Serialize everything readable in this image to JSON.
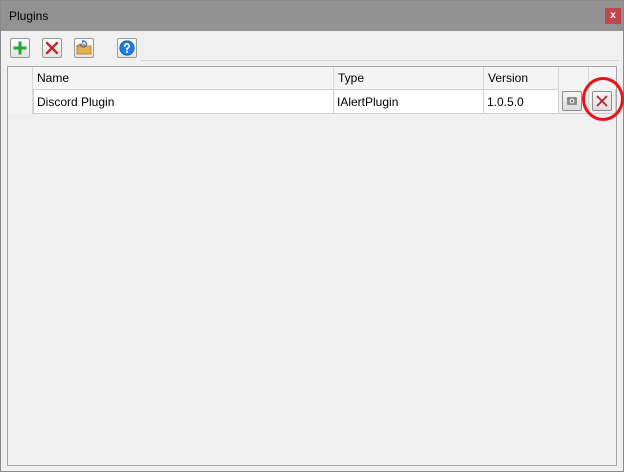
{
  "window": {
    "title": "Plugins",
    "close_label": "x"
  },
  "toolbar": {
    "buttons": [
      {
        "icon": "add-icon",
        "color": "#1a9c2a"
      },
      {
        "icon": "delete-icon",
        "color": "#c0282d"
      },
      {
        "icon": "folder-refresh-icon",
        "color": "#3f6fd1"
      },
      {
        "icon": "help-icon",
        "color": "#1e7de0"
      }
    ]
  },
  "grid": {
    "columns": [
      "Name",
      "Type",
      "Version"
    ],
    "rows": [
      {
        "name": "Discord Plugin",
        "type": "IAlertPlugin",
        "version": "1.0.5.0"
      }
    ]
  },
  "colors": {
    "titlebar": "#929292",
    "close_button": "#c0474b",
    "annotation_ring": "#e8141a"
  }
}
